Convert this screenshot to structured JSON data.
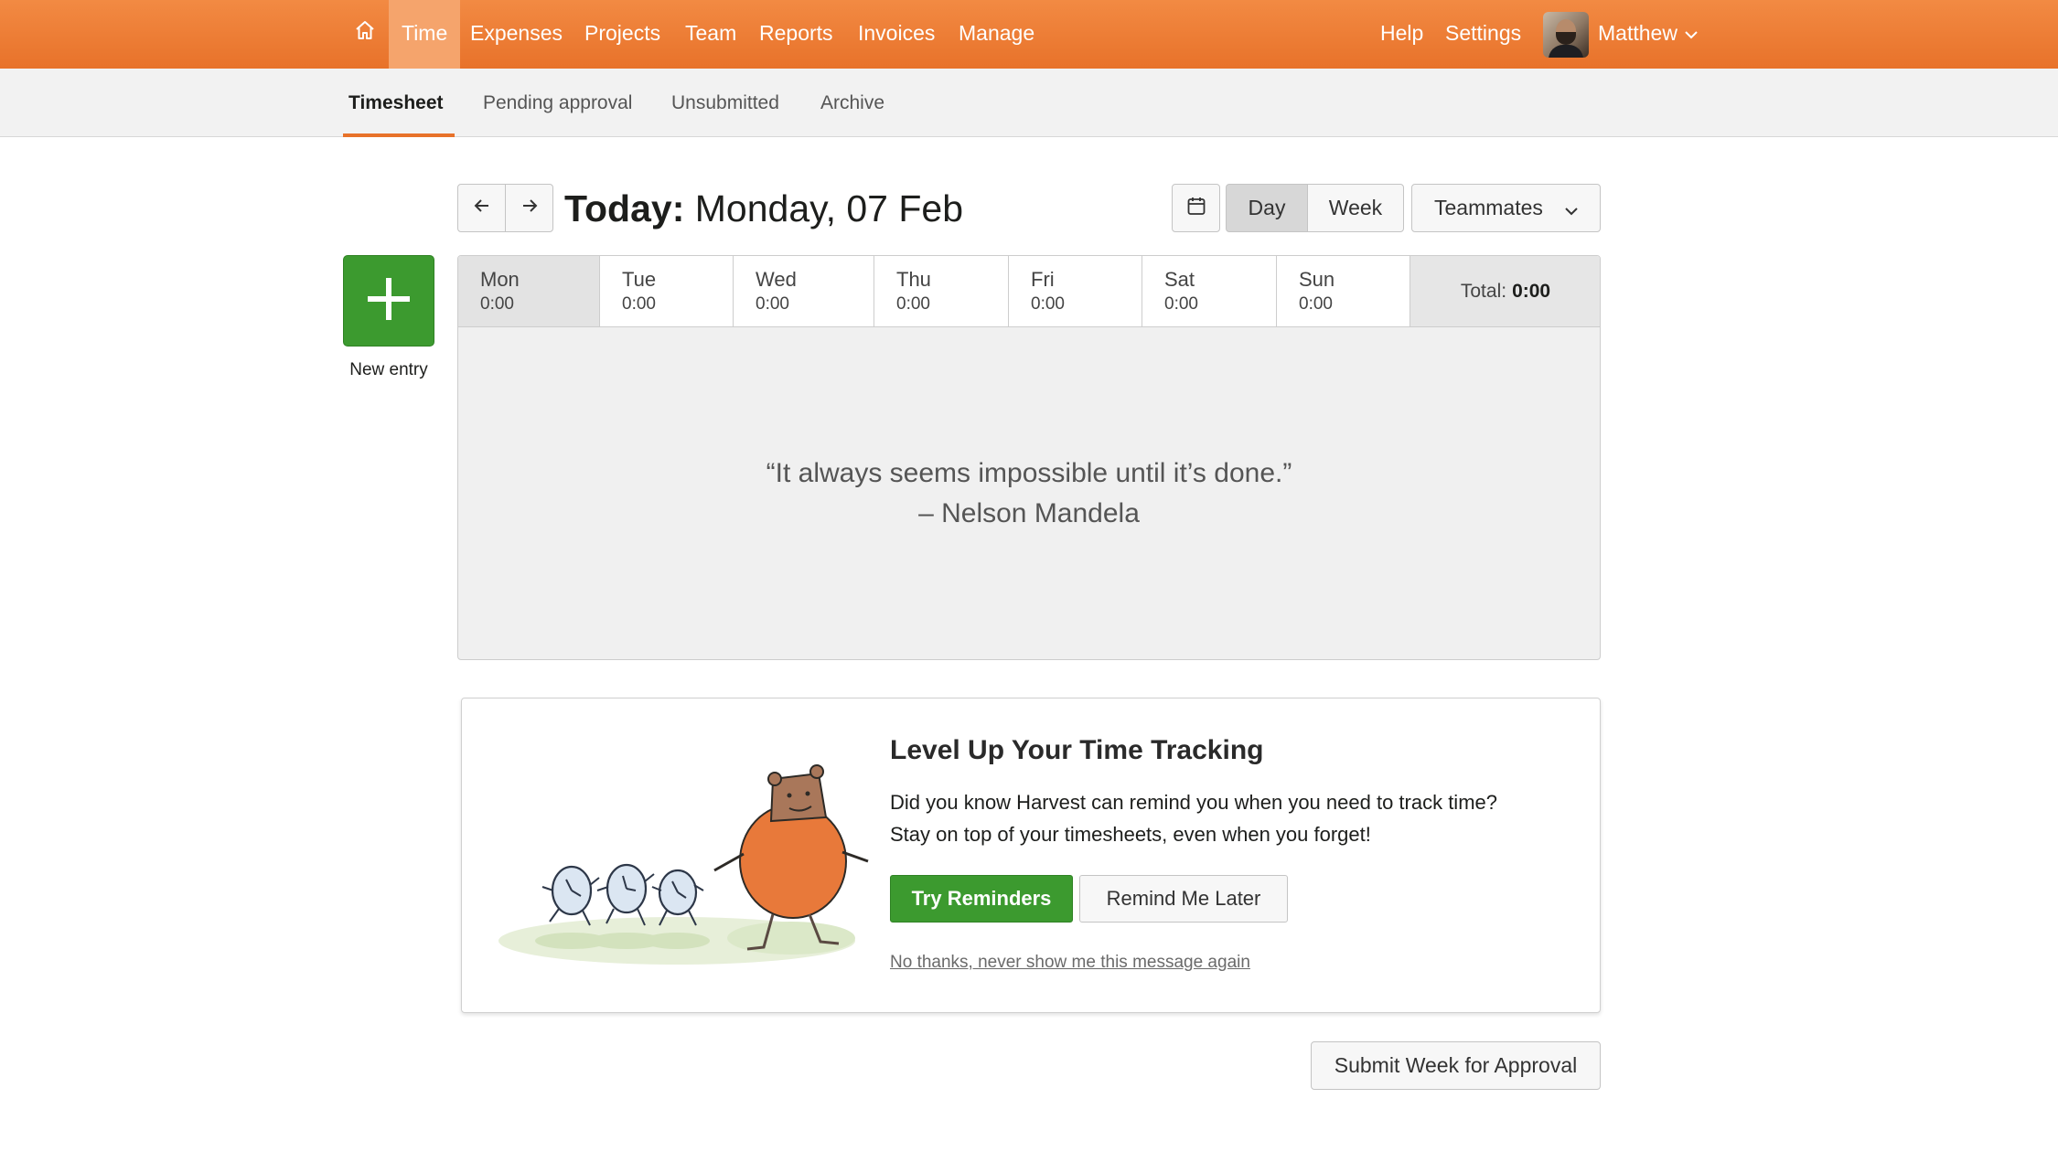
{
  "topnav": {
    "items": [
      "Time",
      "Expenses",
      "Projects",
      "Team",
      "Reports",
      "Invoices",
      "Manage"
    ],
    "active": "Time",
    "right": {
      "help": "Help",
      "settings": "Settings",
      "user": "Matthew"
    }
  },
  "subnav": {
    "tabs": [
      "Timesheet",
      "Pending approval",
      "Unsubmitted",
      "Archive"
    ],
    "active": "Timesheet"
  },
  "toolbar": {
    "today_prefix": "Today:",
    "date": "Monday, 07 Feb",
    "view_day": "Day",
    "view_week": "Week",
    "teammates": "Teammates"
  },
  "new_entry": {
    "label": "New entry"
  },
  "week": {
    "days": [
      {
        "name": "Mon",
        "hours": "0:00"
      },
      {
        "name": "Tue",
        "hours": "0:00"
      },
      {
        "name": "Wed",
        "hours": "0:00"
      },
      {
        "name": "Thu",
        "hours": "0:00"
      },
      {
        "name": "Fri",
        "hours": "0:00"
      },
      {
        "name": "Sat",
        "hours": "0:00"
      },
      {
        "name": "Sun",
        "hours": "0:00"
      }
    ],
    "selected": "Mon",
    "total_label": "Total:",
    "total_value": "0:00",
    "quote_line1": "“It always seems impossible until it’s done.”",
    "quote_line2": "– Nelson Mandela"
  },
  "promo": {
    "title": "Level Up Your Time Tracking",
    "body_line1": "Did you know Harvest can remind you when you need to track time?",
    "body_line2": "Stay on top of your timesheets, even when you forget!",
    "primary": "Try Reminders",
    "secondary": "Remind Me Later",
    "dismiss": "No thanks, never show me this message again"
  },
  "submit": {
    "label": "Submit Week for Approval"
  },
  "colors": {
    "brand_orange": "#e8722a",
    "nav_active": "#f5a46c",
    "green": "#3c9a2f"
  },
  "icons": [
    "home-icon",
    "chevron-down-icon",
    "arrow-left-icon",
    "arrow-right-icon",
    "calendar-icon",
    "plus-icon"
  ]
}
